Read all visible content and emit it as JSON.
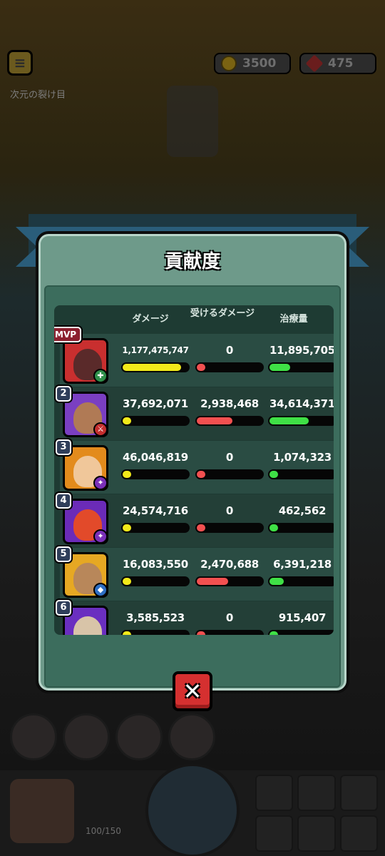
{
  "hud": {
    "menu_icon": "menu-icon",
    "coins": "3500",
    "gems": "475",
    "stage_name": "次元の裂け目",
    "energy": "100/150"
  },
  "modal": {
    "title": "貢献度",
    "close_icon": "close-icon",
    "headers": {
      "damage": "ダメージ",
      "damage_taken": "受けるダメージ",
      "healing": "治療量"
    },
    "colors": {
      "damage_bar": "#f2ea1a",
      "damage_taken_bar": "#f25050",
      "healing_bar": "#3fe046"
    },
    "rows": [
      {
        "rank": "MVP",
        "damage": "1,177,475,747",
        "damage_taken": "0",
        "healing": "11,895,705",
        "damage_frac": 0.98,
        "taken_frac": 0.0,
        "heal_frac": 0.34,
        "role": "healer"
      },
      {
        "rank": "2",
        "damage": "37,692,071",
        "damage_taken": "2,938,468",
        "healing": "34,614,371",
        "damage_frac": 0.12,
        "taken_frac": 0.6,
        "heal_frac": 0.66,
        "role": "warrior"
      },
      {
        "rank": "3",
        "damage": "46,046,819",
        "damage_taken": "0",
        "healing": "1,074,323",
        "damage_frac": 0.12,
        "taken_frac": 0.0,
        "heal_frac": 0.12,
        "role": "mage"
      },
      {
        "rank": "4",
        "damage": "24,574,716",
        "damage_taken": "0",
        "healing": "462,562",
        "damage_frac": 0.12,
        "taken_frac": 0.0,
        "heal_frac": 0.12,
        "role": "mage"
      },
      {
        "rank": "5",
        "damage": "16,083,550",
        "damage_taken": "2,470,688",
        "healing": "6,391,218",
        "damage_frac": 0.12,
        "taken_frac": 0.52,
        "heal_frac": 0.24,
        "role": "tank"
      },
      {
        "rank": "6",
        "damage": "3,585,523",
        "damage_taken": "0",
        "healing": "915,407",
        "damage_frac": 0.12,
        "taken_frac": 0.0,
        "heal_frac": 0.12,
        "role": "healer"
      }
    ]
  }
}
